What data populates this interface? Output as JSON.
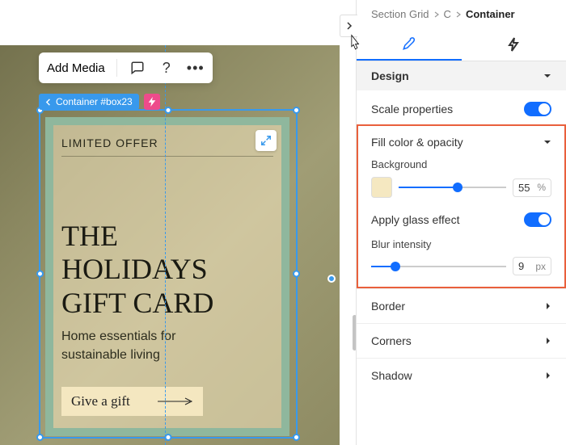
{
  "toolbar": {
    "add_media": "Add Media"
  },
  "selection": {
    "tag": "Container #box23"
  },
  "card": {
    "eyebrow": "LIMITED OFFER",
    "headline_l1": "THE",
    "headline_l2": "HOLIDAYS",
    "headline_l3": "GIFT CARD",
    "sub_l1": "Home essentials for",
    "sub_l2": "sustainable living",
    "cta": "Give a gift"
  },
  "breadcrumb": {
    "a": "Section Grid",
    "b": "C",
    "c": "Container"
  },
  "panel": {
    "design": "Design",
    "scale_properties": "Scale properties",
    "fill_section": "Fill color & opacity",
    "background": "Background",
    "opacity_value": "55",
    "opacity_unit": "%",
    "apply_glass": "Apply glass effect",
    "blur_label": "Blur intensity",
    "blur_value": "9",
    "blur_unit": "px",
    "border": "Border",
    "corners": "Corners",
    "shadow": "Shadow"
  },
  "colors": {
    "swatch": "#f5e8c1"
  }
}
